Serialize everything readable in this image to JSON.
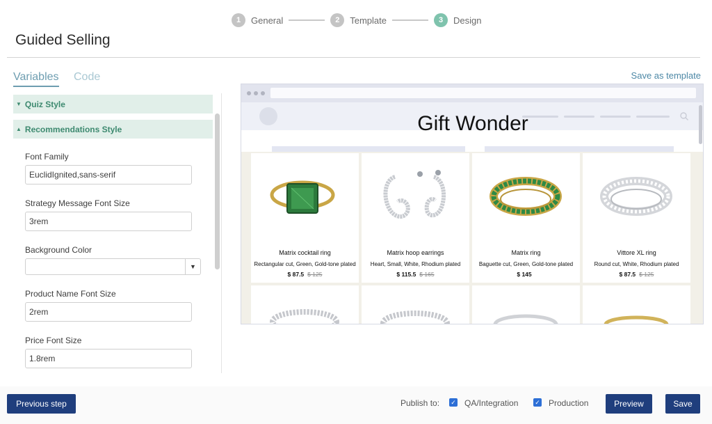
{
  "steps": [
    {
      "number": "1",
      "label": "General"
    },
    {
      "number": "2",
      "label": "Template"
    },
    {
      "number": "3",
      "label": "Design"
    }
  ],
  "page_title": "Guided Selling",
  "tabs": {
    "variables": "Variables",
    "code": "Code"
  },
  "save_as_template": "Save as template",
  "sections": {
    "quiz_style": "Quiz Style",
    "recommendations_style": "Recommendations Style"
  },
  "fields": {
    "font_family": {
      "label": "Font Family",
      "value": "EuclidIgnited,sans-serif"
    },
    "strategy_message_font_size": {
      "label": "Strategy Message Font Size",
      "value": "3rem"
    },
    "background_color": {
      "label": "Background Color",
      "value": ""
    },
    "product_name_font_size": {
      "label": "Product Name Font Size",
      "value": "2rem"
    },
    "price_font_size": {
      "label": "Price Font Size",
      "value": "1.8rem"
    }
  },
  "preview": {
    "store_title": "Gift Wonder",
    "products": [
      {
        "name": "Matrix cocktail ring",
        "desc": "Rectangular cut, Green, Gold-tone plated",
        "price": "$ 87.5",
        "old_price": "$ 125",
        "image_icon": "green-cocktail-ring-icon"
      },
      {
        "name": "Matrix hoop earrings",
        "desc": "Heart, Small, White, Rhodium plated",
        "price": "$ 115.5",
        "old_price": "$ 165",
        "image_icon": "hoop-earrings-icon"
      },
      {
        "name": "Matrix ring",
        "desc": "Baguette cut, Green, Gold-tone plated",
        "price": "$ 145",
        "old_price": "",
        "image_icon": "green-eternity-ring-icon"
      },
      {
        "name": "Vittore XL ring",
        "desc": "Round cut, White, Rhodium plated",
        "price": "$ 87.5",
        "old_price": "$ 125",
        "image_icon": "crystal-ring-icon"
      }
    ]
  },
  "footer": {
    "previous_step": "Previous step",
    "publish_to": "Publish to:",
    "qa_integration": {
      "label": "QA/Integration",
      "checked": true
    },
    "production": {
      "label": "Production",
      "checked": true
    },
    "preview": "Preview",
    "save": "Save"
  },
  "colors": {
    "accent": "#7fc3ad",
    "section_bg": "#e1efe9",
    "section_text": "#3e8a70",
    "primary_button": "#1f3e7d",
    "link": "#4d88a6",
    "checkbox": "#2d6fd6"
  }
}
